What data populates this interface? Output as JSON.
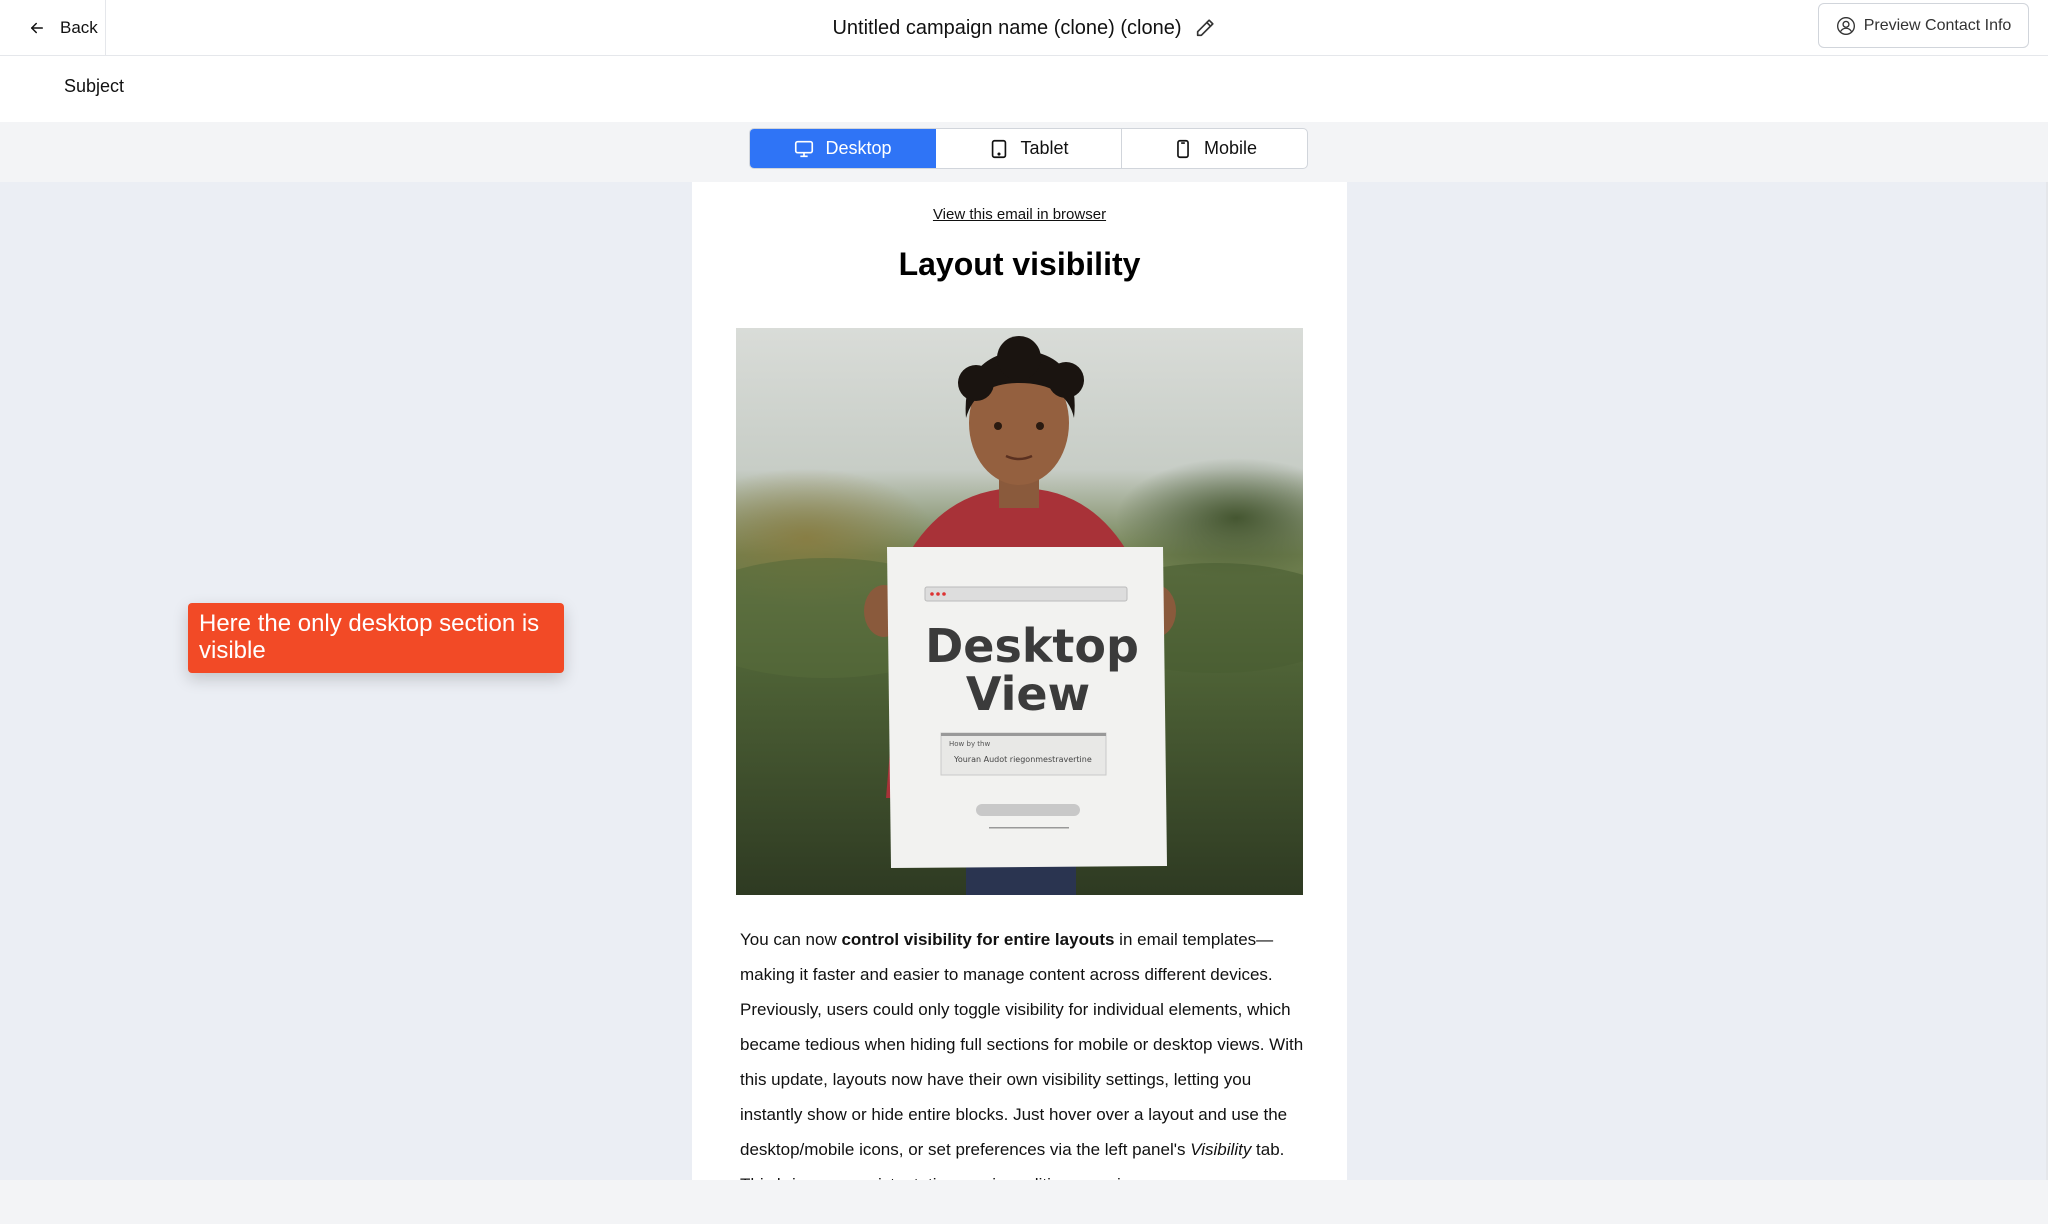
{
  "header": {
    "back_label": "Back",
    "campaign_title": "Untitled campaign name (clone) (clone)",
    "preview_label": "Preview Contact Info"
  },
  "subject": {
    "label": "Subject"
  },
  "device_toggle": {
    "selected": "Desktop",
    "options": [
      {
        "label": "Desktop",
        "icon": "monitor-icon"
      },
      {
        "label": "Tablet",
        "icon": "tablet-icon"
      },
      {
        "label": "Mobile",
        "icon": "mobile-icon"
      }
    ]
  },
  "email": {
    "view_in_browser": "View this email in browser",
    "title": "Layout visibility",
    "hero_sign": {
      "line1": "Desktop",
      "line2": "View",
      "small1": "How by thw",
      "small2": "Youran Audot riegonmestravertine"
    },
    "body": {
      "p1": "You can now ",
      "bold1": "control visibility for entire layouts",
      "p2": " in email templates—making it faster and easier to manage content across different devices. Previously, users could only toggle visibility for individual elements, which became tedious when hiding full sections for mobile or desktop views. With this update, layouts now have their own visibility settings, letting you instantly show or hide entire blocks. Just hover over a layout and use the desktop/mobile icons, or set preferences via the left panel's ",
      "italic1": "Visibility",
      "p3": " tab. This brings a consistent, time-saving editing experience."
    }
  },
  "callout": {
    "text": "Here the only desktop section is visible"
  },
  "colors": {
    "accent": "#2f74f6",
    "callout": "#f24a26"
  }
}
